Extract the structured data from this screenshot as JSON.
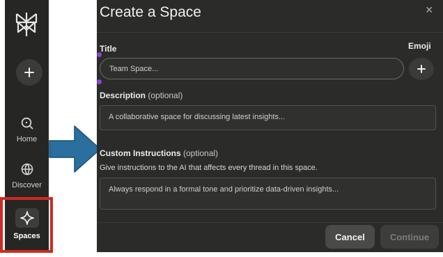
{
  "sidebar": {
    "logo_icon": "perplexity-logo-icon",
    "new_thread_icon": "plus-icon",
    "items": [
      {
        "label": "Home",
        "icon": "search-icon"
      },
      {
        "label": "Discover",
        "icon": "globe-icon"
      },
      {
        "label": "Spaces",
        "icon": "sparkle-icon",
        "active": true
      }
    ]
  },
  "annotation": {
    "highlight_color": "#cf2a22",
    "arrow_color": "#2a6f9e"
  },
  "modal": {
    "title": "Create a Space",
    "close_icon": "close-icon",
    "title_field": {
      "label": "Title",
      "placeholder": "Team Space..."
    },
    "emoji": {
      "label": "Emoji",
      "icon": "plus-icon"
    },
    "description": {
      "label": "Description",
      "optional": "(optional)",
      "placeholder": "A collaborative space for discussing latest insights..."
    },
    "instructions": {
      "label": "Custom Instructions",
      "optional": "(optional)",
      "hint": "Give instructions to the AI that affects every thread in this space.",
      "placeholder": "Always respond in a formal tone and prioritize data-driven insights..."
    },
    "buttons": {
      "cancel": "Cancel",
      "continue": "Continue"
    }
  }
}
